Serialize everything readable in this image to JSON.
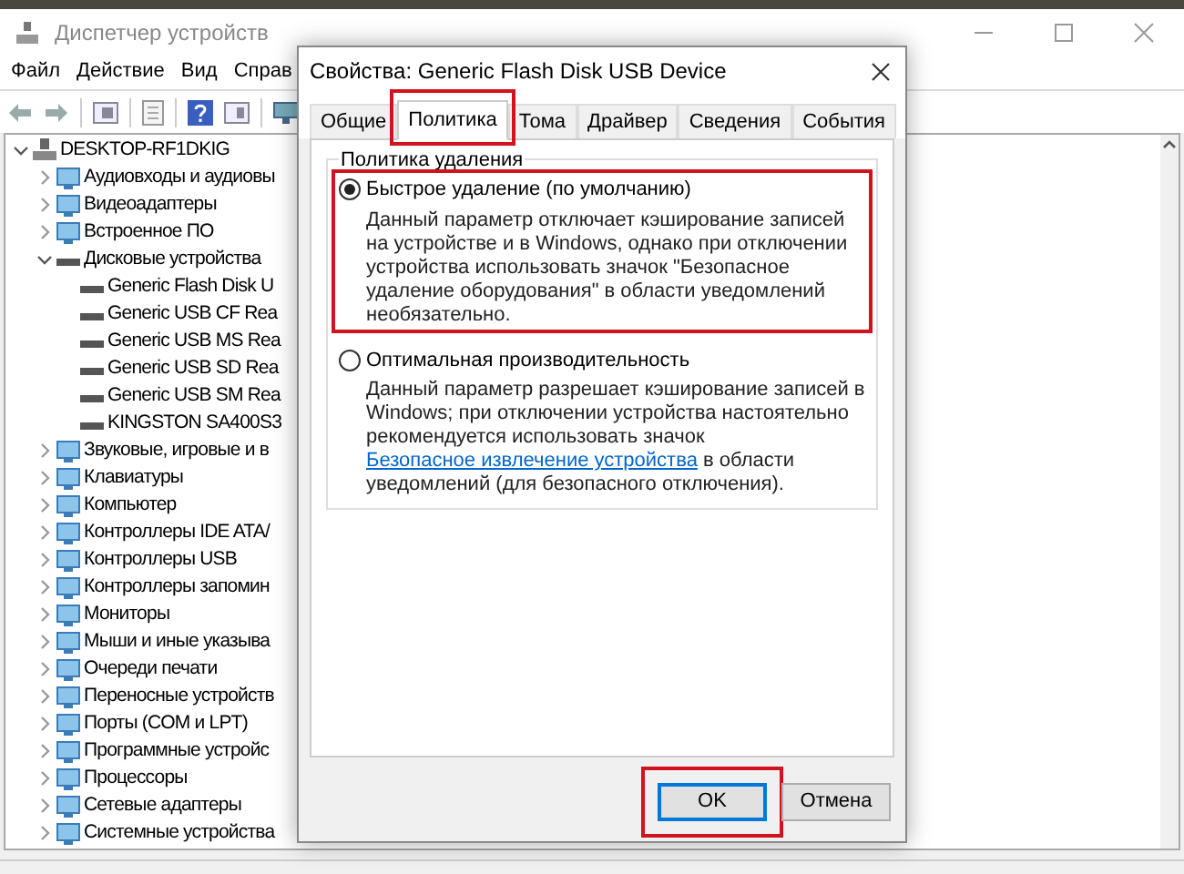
{
  "window": {
    "title": "Диспетчер устройств"
  },
  "menu": [
    "Файл",
    "Действие",
    "Вид",
    "Справ"
  ],
  "tree": {
    "label": "DESKTOP-RF1DKIG",
    "expanded": true,
    "children": [
      {
        "label": "Аудиовходы и аудиовы",
        "expanded": false
      },
      {
        "label": "Видеоадаптеры",
        "expanded": false
      },
      {
        "label": "Встроенное ПО",
        "expanded": false
      },
      {
        "label": "Дисковые устройства",
        "expanded": true,
        "children": [
          {
            "label": "Generic Flash Disk U"
          },
          {
            "label": "Generic USB CF Rea"
          },
          {
            "label": "Generic USB MS Rea"
          },
          {
            "label": "Generic USB SD Rea"
          },
          {
            "label": "Generic USB SM Rea"
          },
          {
            "label": "KINGSTON SA400S3"
          }
        ]
      },
      {
        "label": "Звуковые, игровые и в",
        "expanded": false
      },
      {
        "label": "Клавиатуры",
        "expanded": false
      },
      {
        "label": "Компьютер",
        "expanded": false
      },
      {
        "label": "Контроллеры IDE ATA/",
        "expanded": false
      },
      {
        "label": "Контроллеры USB",
        "expanded": false
      },
      {
        "label": "Контроллеры запомин",
        "expanded": false
      },
      {
        "label": "Мониторы",
        "expanded": false
      },
      {
        "label": "Мыши и иные указыва",
        "expanded": false
      },
      {
        "label": "Очереди печати",
        "expanded": false
      },
      {
        "label": "Переносные устройств",
        "expanded": false
      },
      {
        "label": "Порты (COM и LPT)",
        "expanded": false
      },
      {
        "label": "Программные устройс",
        "expanded": false
      },
      {
        "label": "Процессоры",
        "expanded": false
      },
      {
        "label": "Сетевые адаптеры",
        "expanded": false
      },
      {
        "label": "Системные устройства",
        "expanded": false
      }
    ]
  },
  "dialog": {
    "title": "Свойства: Generic Flash Disk USB Device",
    "tabs": [
      {
        "label": "Общие",
        "selected": false,
        "highlighted": false
      },
      {
        "label": "Политика",
        "selected": true,
        "highlighted": true
      },
      {
        "label": "Тома",
        "selected": false,
        "highlighted": false
      },
      {
        "label": "Драйвер",
        "selected": false,
        "highlighted": false
      },
      {
        "label": "Сведения",
        "selected": false,
        "highlighted": false
      },
      {
        "label": "События",
        "selected": false,
        "highlighted": false
      }
    ],
    "group_title": "Политика удаления",
    "options": [
      {
        "label": "Быстрое удаление (по умолчанию)",
        "selected": true,
        "highlighted": true,
        "description": "Данный параметр отключает кэширование записей на устройстве и в Windows, однако при отключении устройства использовать значок \"Безопасное удаление оборудования\" в области уведомлений необязательно."
      },
      {
        "label": "Оптимальная производительность",
        "selected": false,
        "highlighted": false,
        "description": "Данный параметр разрешает кэширование записей в Windows; при отключении устройства настоятельно рекомендуется использовать значок",
        "link": "Безопасное извлечение устройства",
        "description_after": "в области уведомлений (для безопасного отключения)."
      }
    ],
    "buttons": [
      {
        "label": "OK",
        "default": true,
        "highlighted": true
      },
      {
        "label": "Отмена",
        "default": false,
        "highlighted": false
      }
    ]
  }
}
